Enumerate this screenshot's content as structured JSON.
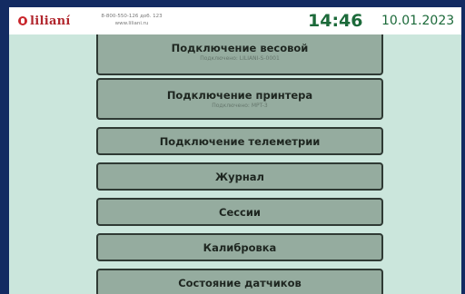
{
  "header": {
    "logo_text": "lilianí",
    "phone": "8-800-550-126 доб. 123",
    "website": "www.liliani.ru",
    "time": "14:46",
    "date": "10.01.2023"
  },
  "menu": {
    "items": [
      {
        "label": "Подключение весовой",
        "sub": "Подключено: LILIANI-S-0001"
      },
      {
        "label": "Подключение принтера",
        "sub": "Подключено: MPT-3"
      },
      {
        "label": "Подключение телеметрии",
        "sub": ""
      },
      {
        "label": "Журнал",
        "sub": ""
      },
      {
        "label": "Сессии",
        "sub": ""
      },
      {
        "label": "Калибровка",
        "sub": ""
      },
      {
        "label": "Состояние датчиков",
        "sub": ""
      }
    ]
  },
  "colors": {
    "background": "#cbe6dc",
    "button": "#95ac9f",
    "border": "#2f3a34",
    "clock": "#1c6a3a",
    "brand": "#b1262d"
  }
}
